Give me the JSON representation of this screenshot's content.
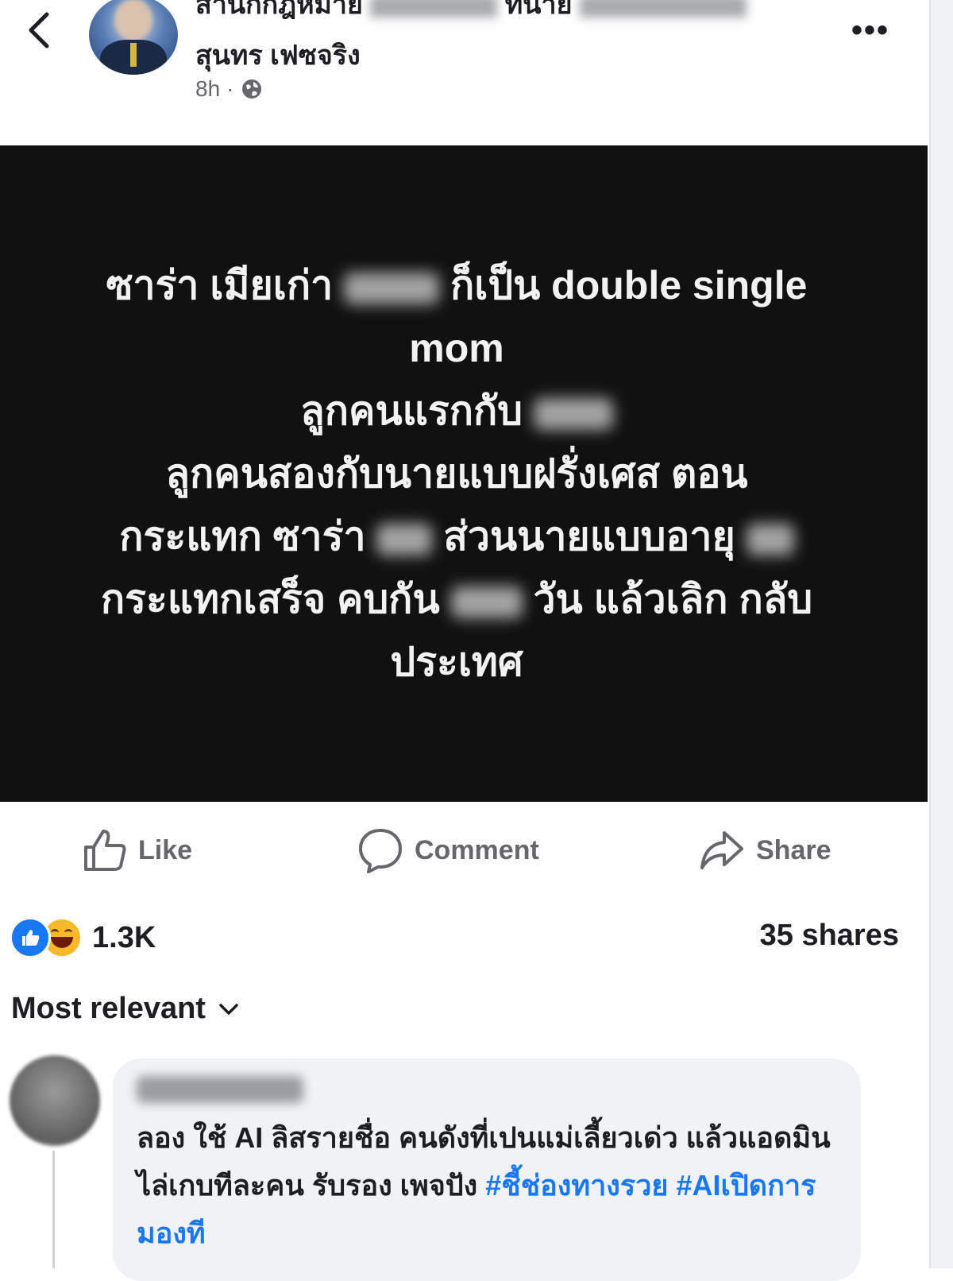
{
  "header": {
    "page_name_line1": "สำนักกฎหมาย",
    "page_name_line1_suffix": "ทนาย",
    "page_name_line2": "สุนทร เฟซจริง",
    "time": "8h",
    "privacy_icon": "globe-icon",
    "more_icon": "more-icon",
    "back_icon": "chevron-left-icon"
  },
  "post": {
    "lines": [
      {
        "pre": "ซาร่า เมียเก่า",
        "post": "ก็เป็น double single"
      },
      {
        "text": "mom"
      },
      {
        "pre": "ลูกคนแรกกับ",
        "post": ""
      },
      {
        "text": "ลูกคนสองกับนายแบบฝรั่งเศส ตอน"
      },
      {
        "pre": "กระแทก ซาร่า",
        "mid": "ส่วนนายแบบอายุ",
        "post": ""
      },
      {
        "pre": "กระแทกเสร็จ คบกัน",
        "post": "วัน แล้วเลิก กลับ"
      },
      {
        "text": "ประเทศ"
      }
    ]
  },
  "actions": {
    "like": "Like",
    "comment": "Comment",
    "share": "Share"
  },
  "stats": {
    "reaction_count": "1.3K",
    "shares": "35 shares",
    "colors": {
      "like": "#1877f2",
      "haha": "#f7b928"
    }
  },
  "comments": {
    "sort_label": "Most relevant",
    "items": [
      {
        "text": "ลอง ใช้ AI ลิสรายชื่อ คนดังที่เปนแม่เลี้ยวเด่ว แล้วแอดมินไล่เกบทีละคน รับรอง เพจปัง",
        "hashtag1": "#ชี้ช่องทางรวย",
        "hashtag2": "#AIเปิดการมองที"
      }
    ]
  }
}
